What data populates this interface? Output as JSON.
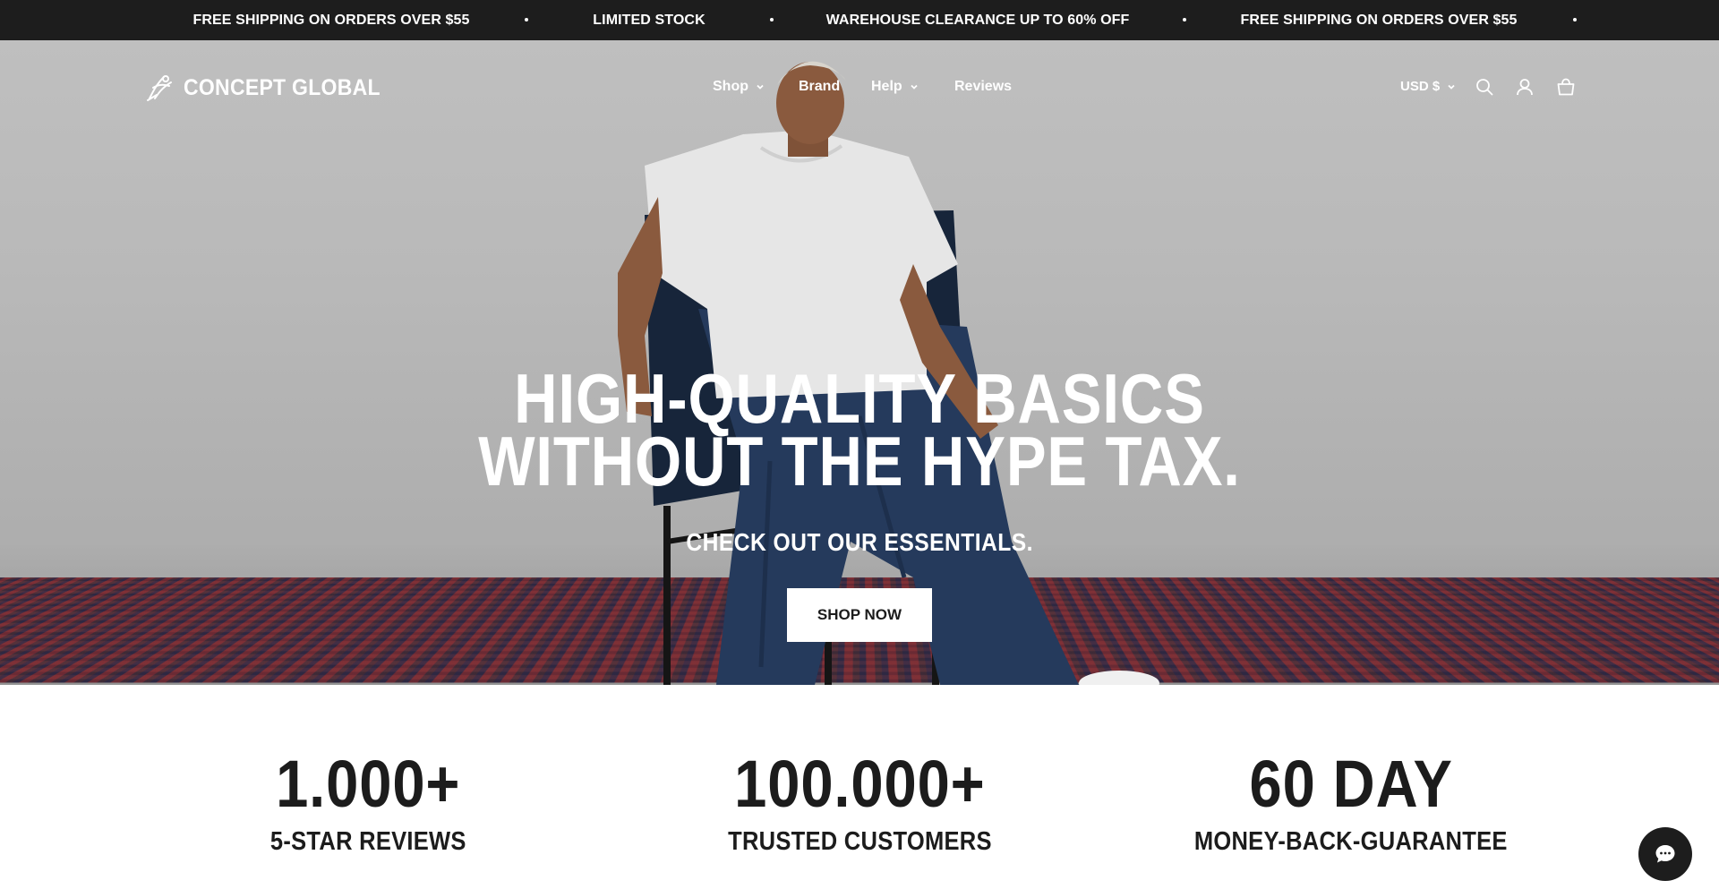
{
  "announcement": {
    "messages": [
      "FREE SHIPPING ON ORDERS OVER $55",
      "LIMITED STOCK",
      "WAREHOUSE CLEARANCE UP TO 60% OFF",
      "FREE SHIPPING ON ORDERS OVER $55"
    ]
  },
  "header": {
    "brand": "CONCEPT GLOBAL",
    "nav": [
      {
        "label": "Shop",
        "has_dropdown": true
      },
      {
        "label": "Brand",
        "has_dropdown": false
      },
      {
        "label": "Help",
        "has_dropdown": true
      },
      {
        "label": "Reviews",
        "has_dropdown": false
      }
    ],
    "currency": "USD $",
    "icons": [
      "search-icon",
      "account-icon",
      "cart-icon"
    ]
  },
  "hero": {
    "headline_line1": "HIGH-QUALITY BASICS",
    "headline_line2": "WITHOUT THE HYPE TAX.",
    "subheading": "CHECK OUT OUR ESSENTIALS.",
    "cta_label": "SHOP NOW"
  },
  "stats": [
    {
      "number": "1.000+",
      "label": "5-STAR REVIEWS"
    },
    {
      "number": "100.000+",
      "label": "TRUSTED CUSTOMERS"
    },
    {
      "number": "60 DAY",
      "label": "MONEY-BACK-GUARANTEE"
    }
  ],
  "colors": {
    "announcement_bg": "#1d1d1d",
    "text_dark": "#1c1c1c",
    "hero_text": "#ffffff",
    "chat_bg": "#1d1d1d"
  },
  "chat_widget": {
    "icon": "chat-icon"
  }
}
